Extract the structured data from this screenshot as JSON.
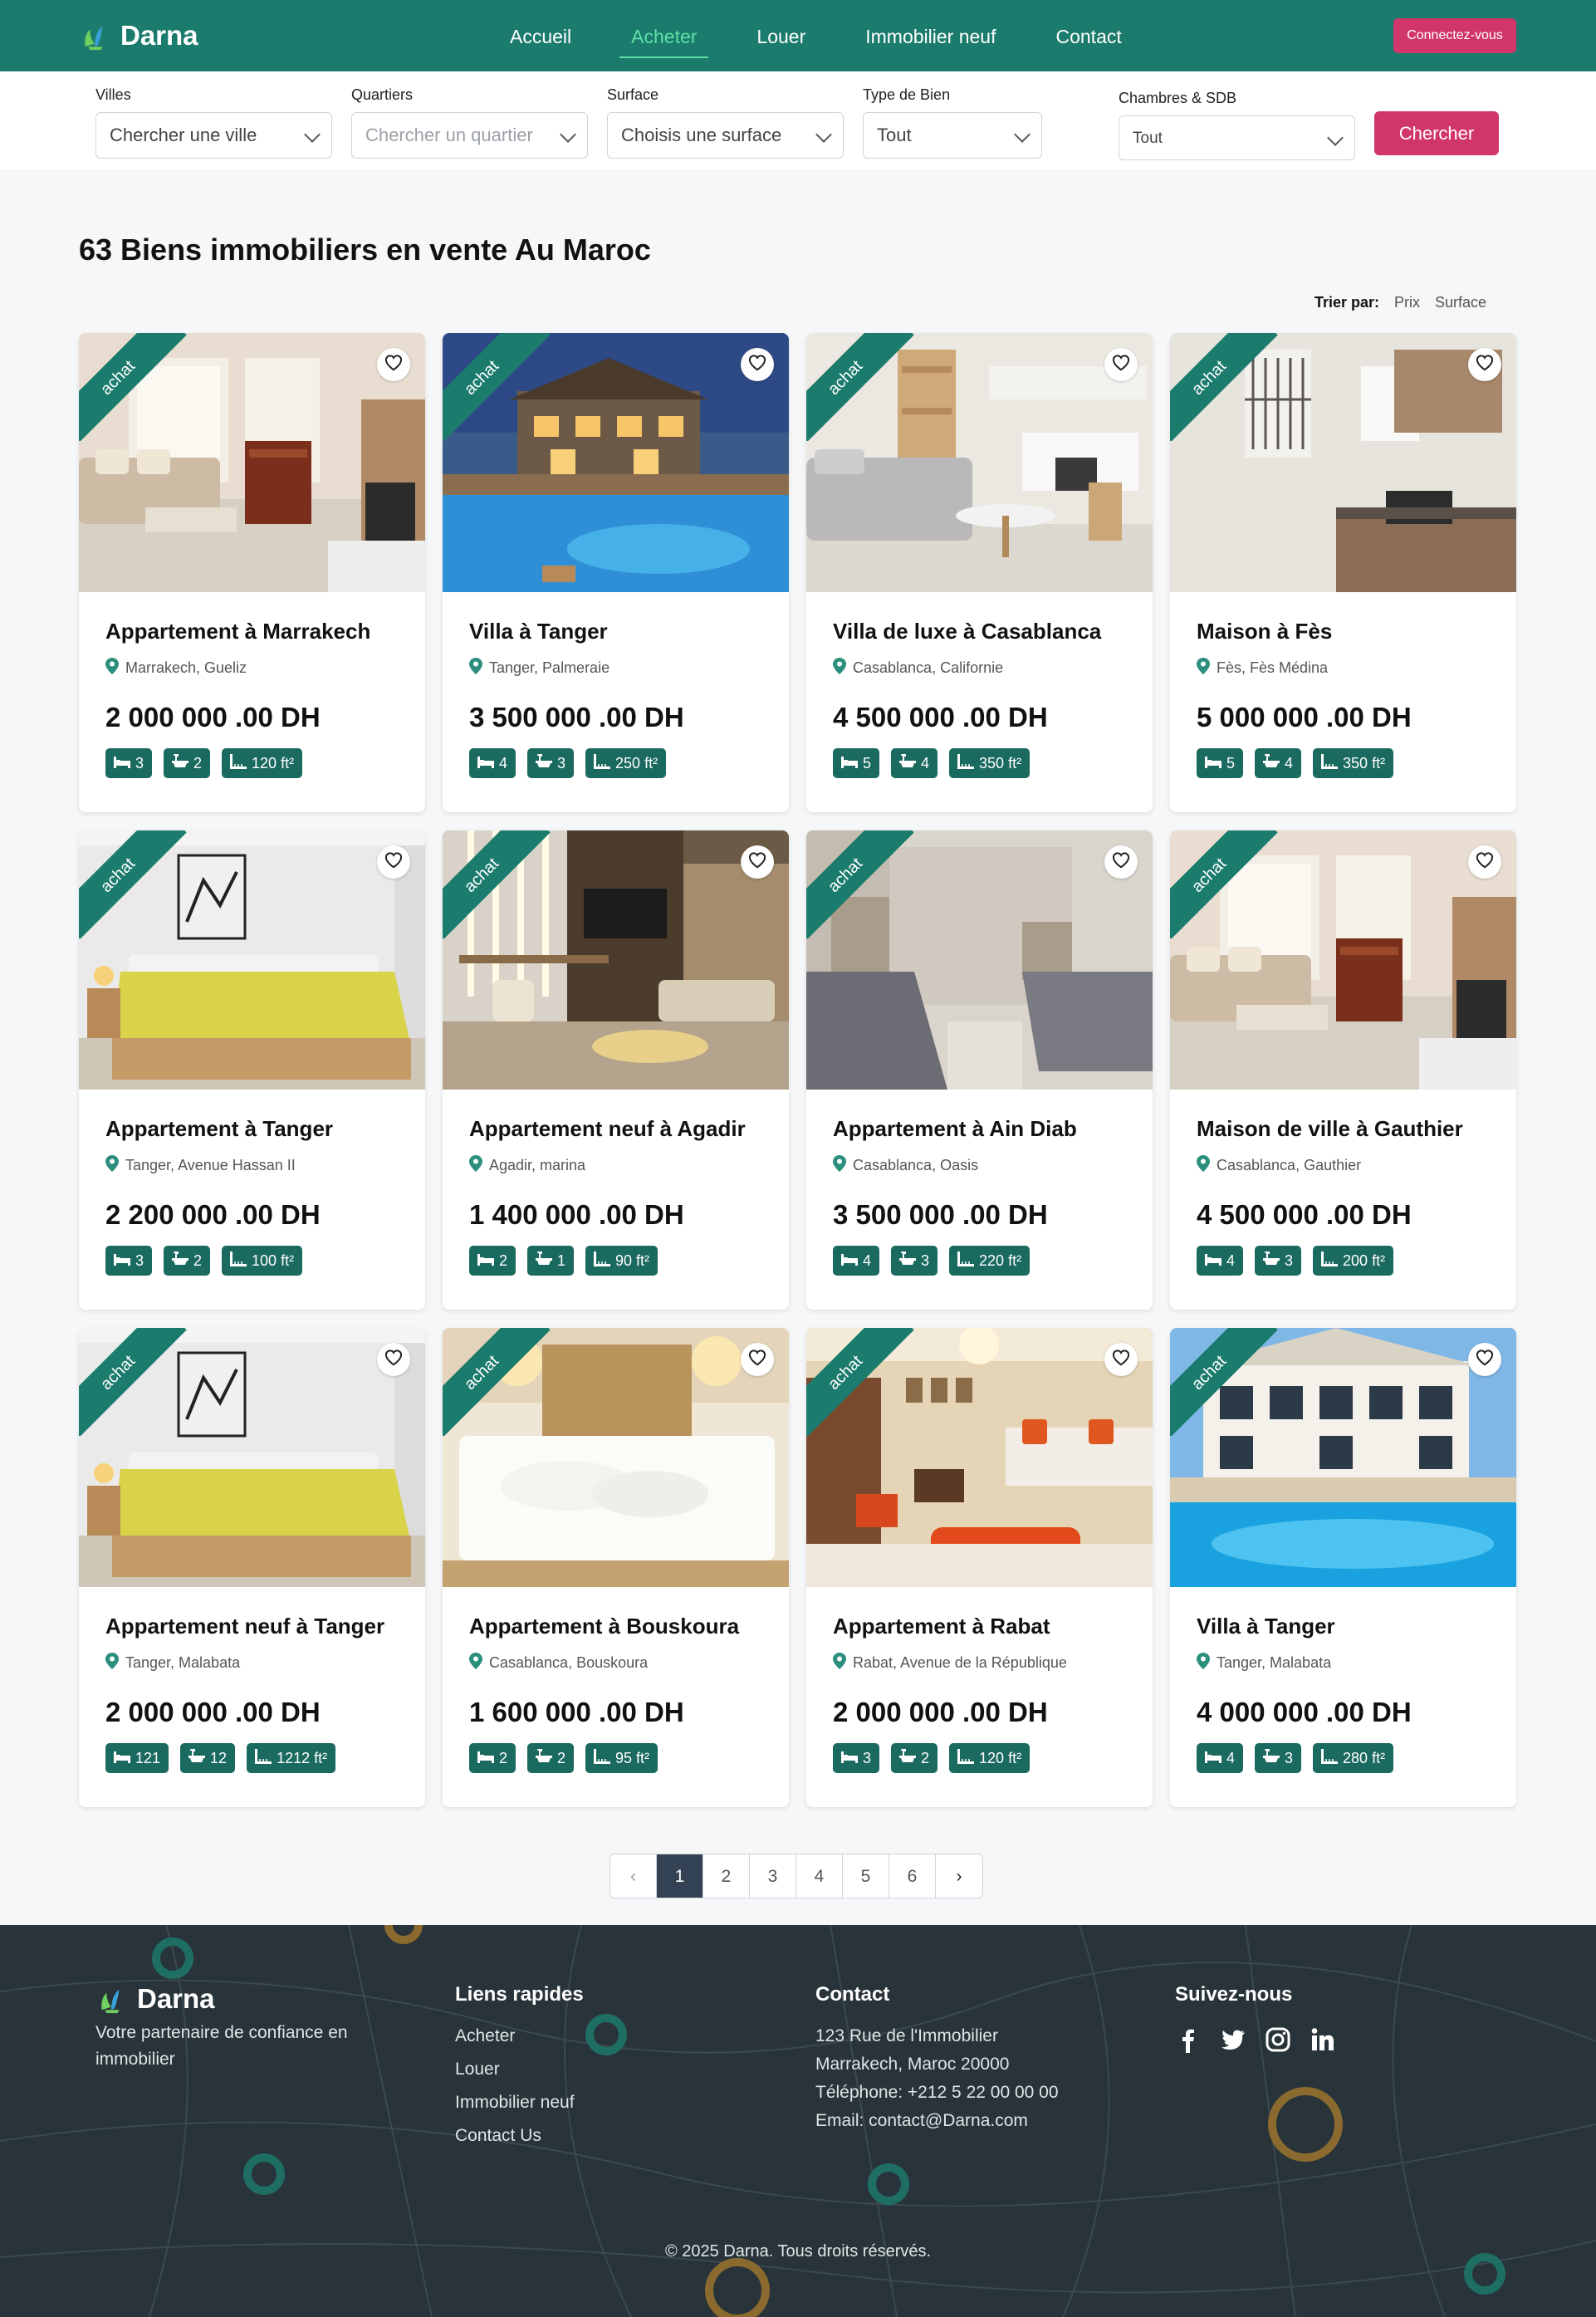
{
  "brand": {
    "name": "Darna",
    "primary": "#1b7b6c",
    "accent": "#d1366b"
  },
  "nav": {
    "links": [
      {
        "label": "Accueil",
        "active": false
      },
      {
        "label": "Acheter",
        "active": true
      },
      {
        "label": "Louer",
        "active": false
      },
      {
        "label": "Immobilier neuf",
        "active": false
      },
      {
        "label": "Contact",
        "active": false
      }
    ],
    "login_label": "Connectez-vous"
  },
  "search": {
    "filters": [
      {
        "label": "Villes",
        "value": "Chercher une ville",
        "placeholder": false
      },
      {
        "label": "Quartiers",
        "value": "Chercher un quartier",
        "placeholder": true
      },
      {
        "label": "Surface",
        "value": "Choisis une surface",
        "placeholder": false
      },
      {
        "label": "Type de Bien",
        "value": "Tout",
        "placeholder": false
      },
      {
        "label": "Chambres & SDB",
        "value": "Tout",
        "placeholder": false
      }
    ],
    "button_label": "Chercher"
  },
  "listing": {
    "heading": "63 Biens immobiliers en vente Au Maroc",
    "sort_label": "Trier par:",
    "sort_options": [
      "Prix",
      "Surface"
    ]
  },
  "cards": [
    {
      "badge": "achat",
      "title": "Appartement à Marrakech",
      "location": "Marrakech, Gueliz",
      "price": "2 000 000 .00 DH",
      "beds": "3",
      "baths": "2",
      "area": "120 ft²",
      "scene": "living"
    },
    {
      "badge": "achat",
      "title": "Villa à Tanger",
      "location": "Tanger, Palmeraie",
      "price": "3 500 000 .00 DH",
      "beds": "4",
      "baths": "3",
      "area": "250 ft²",
      "scene": "pool-night"
    },
    {
      "badge": "achat",
      "title": "Villa de luxe à Casablanca",
      "location": "Casablanca, Californie",
      "price": "4 500 000 .00 DH",
      "beds": "5",
      "baths": "4",
      "area": "350 ft²",
      "scene": "lounge"
    },
    {
      "badge": "achat",
      "title": "Maison à Fès",
      "location": "Fès, Fès Médina",
      "price": "5 000 000 .00 DH",
      "beds": "5",
      "baths": "4",
      "area": "350 ft²",
      "scene": "kitchen"
    },
    {
      "badge": "achat",
      "title": "Appartement à Tanger",
      "location": "Tanger, Avenue Hassan II",
      "price": "2 200 000 .00 DH",
      "beds": "3",
      "baths": "2",
      "area": "100 ft²",
      "scene": "bedroom-yellow"
    },
    {
      "badge": "achat",
      "title": "Appartement neuf à Agadir",
      "location": "Agadir, marina",
      "price": "1 400 000 .00 DH",
      "beds": "2",
      "baths": "1",
      "area": "90 ft²",
      "scene": "modern"
    },
    {
      "badge": "achat",
      "title": "Appartement à Ain Diab",
      "location": "Casablanca, Oasis",
      "price": "3 500 000 .00 DH",
      "beds": "4",
      "baths": "3",
      "area": "220 ft²",
      "scene": "twin"
    },
    {
      "badge": "achat",
      "title": "Maison de ville à Gauthier",
      "location": "Casablanca, Gauthier",
      "price": "4 500 000 .00 DH",
      "beds": "4",
      "baths": "3",
      "area": "200 ft²",
      "scene": "living"
    },
    {
      "badge": "achat",
      "title": "Appartement neuf à Tanger",
      "location": "Tanger, Malabata",
      "price": "2 000 000 .00 DH",
      "beds": "121",
      "baths": "12",
      "area": "1212 ft²",
      "scene": "bedroom-yellow"
    },
    {
      "badge": "achat",
      "title": "Appartement à Bouskoura",
      "location": "Casablanca, Bouskoura",
      "price": "1 600 000 .00 DH",
      "beds": "2",
      "baths": "2",
      "area": "95 ft²",
      "scene": "bed-white"
    },
    {
      "badge": "achat",
      "title": "Appartement à Rabat",
      "location": "Rabat, Avenue de la République",
      "price": "2 000 000 .00 DH",
      "beds": "3",
      "baths": "2",
      "area": "120 ft²",
      "scene": "salon-orange"
    },
    {
      "badge": "achat",
      "title": "Villa à Tanger",
      "location": "Tanger, Malabata",
      "price": "4 000 000 .00 DH",
      "beds": "4",
      "baths": "3",
      "area": "280 ft²",
      "scene": "villa-day"
    }
  ],
  "pagination": {
    "pages": [
      "1",
      "2",
      "3",
      "4",
      "5",
      "6"
    ],
    "current": "1"
  },
  "footer": {
    "tagline": "Votre partenaire de confiance en immobilier",
    "quick_links_heading": "Liens rapides",
    "quick_links": [
      "Acheter",
      "Louer",
      "Immobilier neuf",
      "Contact Us"
    ],
    "contact_heading": "Contact",
    "contact_lines": [
      "123 Rue de l'Immobilier",
      "Marrakech, Maroc 20000",
      "Téléphone: +212 5 22 00 00 00",
      "Email: contact@Darna.com"
    ],
    "social_heading": "Suivez-nous",
    "socials": [
      "facebook-icon",
      "twitter-icon",
      "instagram-icon",
      "linkedin-icon"
    ],
    "copyright": "© 2025 Darna. Tous droits réservés."
  }
}
